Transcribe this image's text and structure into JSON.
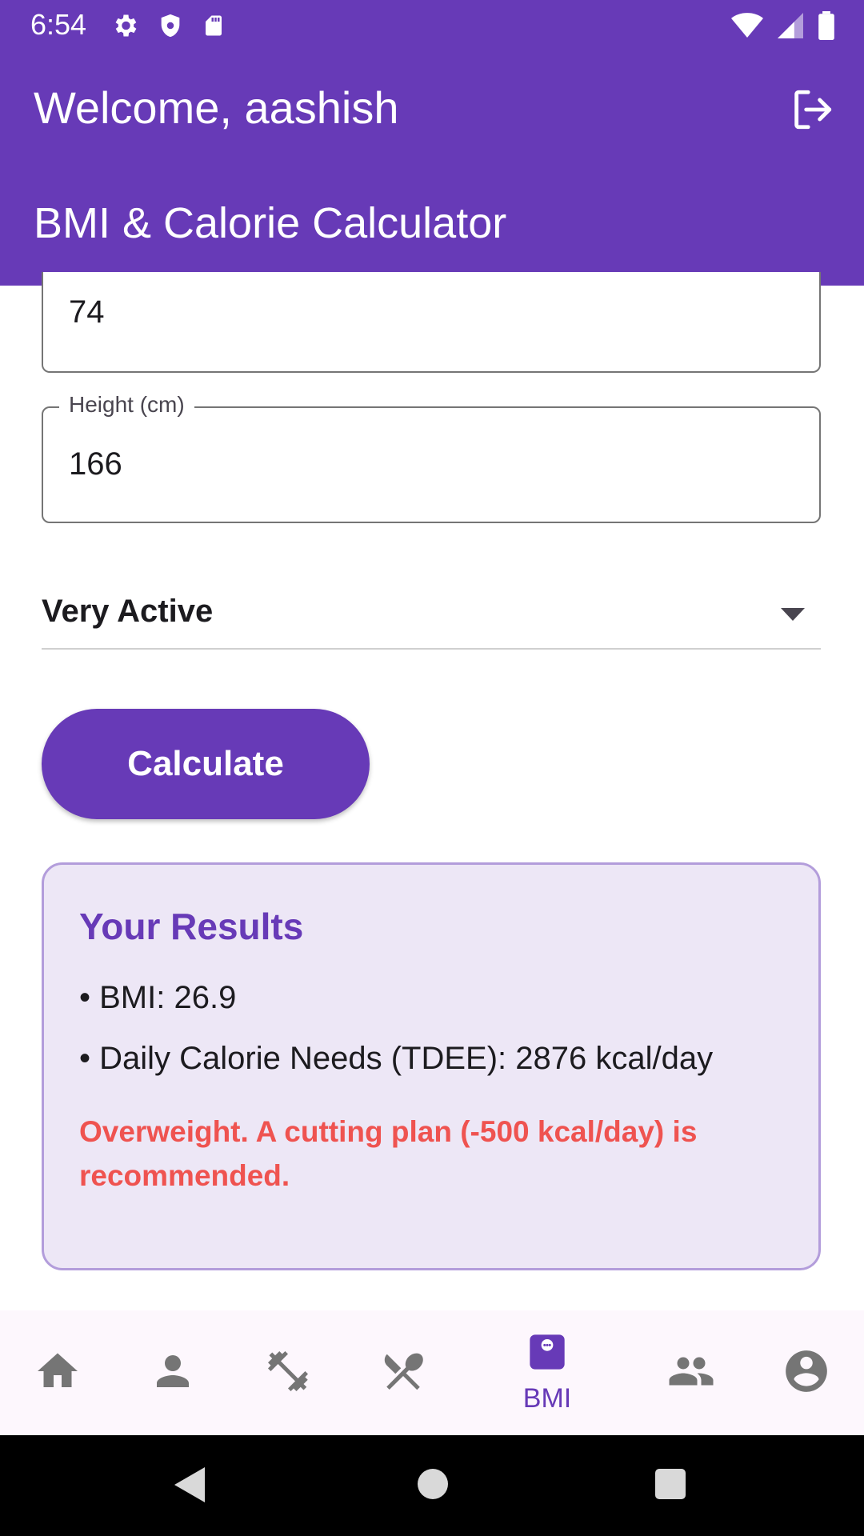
{
  "status_bar": {
    "time": "6:54",
    "left_icons": [
      "gear-icon",
      "shield-icon",
      "sd-card-icon"
    ],
    "right_icons": [
      "wifi-icon",
      "signal-icon",
      "battery-icon"
    ]
  },
  "app_bar": {
    "welcome": "Welcome, aashish",
    "logout_icon": "logout-icon",
    "title": "BMI & Calorie Calculator"
  },
  "form": {
    "weight_value": "74",
    "height_label": "Height (cm)",
    "height_value": "166",
    "activity_level": "Very Active",
    "calculate_label": "Calculate"
  },
  "results": {
    "title": "Your Results",
    "bmi_line": "• BMI: 26.9",
    "tdee_line": "• Daily Calorie Needs (TDEE): 2876 kcal/day",
    "recommendation": "Overweight. A cutting plan (-500 kcal/day) is recommended."
  },
  "bottom_nav": {
    "items": [
      {
        "icon": "home-icon"
      },
      {
        "icon": "person-icon"
      },
      {
        "icon": "dumbbell-icon"
      },
      {
        "icon": "utensils-icon"
      },
      {
        "icon": "bmi-scale-icon",
        "label": "BMI",
        "active": true
      },
      {
        "icon": "group-icon"
      },
      {
        "icon": "account-circle-icon"
      }
    ]
  },
  "colors": {
    "primary": "#673ab7",
    "results_bg": "#ede7f6",
    "results_border": "#b39ddb",
    "warning": "#ef5350",
    "nav_inactive": "#757575"
  }
}
